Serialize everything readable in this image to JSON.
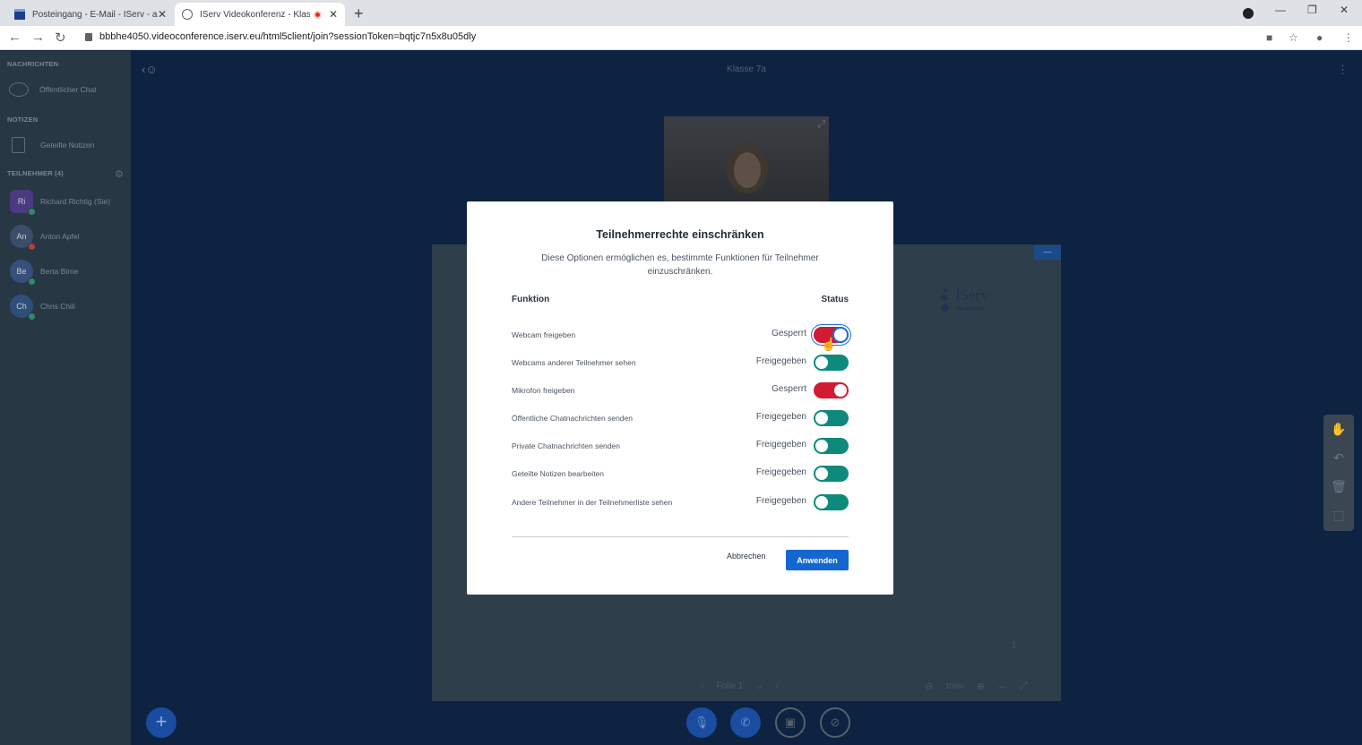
{
  "browser": {
    "tabs": [
      {
        "title": "Posteingang - E-Mail - IServ - ak"
      },
      {
        "title": "IServ Videokonferenz - Klass"
      }
    ],
    "url": "bbbhe4050.videoconference.iserv.eu/html5client/join?sessionToken=bqtjc7n5x8u05dly"
  },
  "sidebar": {
    "messages_title": "NACHRICHTEN",
    "public_chat": "Öffentlicher Chat",
    "notes_title": "NOTIZEN",
    "shared_notes": "Geteilte Notizen",
    "participants_title": "TEILNEHMER (4)",
    "users": [
      {
        "initials": "Ri",
        "name": "Richard Richtig (Sie)"
      },
      {
        "initials": "An",
        "name": "Anton Apfel"
      },
      {
        "initials": "Be",
        "name": "Berta Birne"
      },
      {
        "initials": "Ch",
        "name": "Chris Chili"
      }
    ]
  },
  "main": {
    "meeting_title": "Klasse 7a",
    "logo": {
      "name": "IServ",
      "sub": "Akademie"
    },
    "page_number": "1",
    "slide_label": "Folie 1",
    "zoom": "100%"
  },
  "modal": {
    "title": "Teilnehmerrechte einschränken",
    "description": "Diese Optionen ermöglichen es, bestimmte Funktionen für Teilnehmer einzuschränken.",
    "col_function": "Funktion",
    "col_status": "Status",
    "permissions": [
      {
        "label": "Webcam freigeben",
        "status": "Gesperrt",
        "locked": true
      },
      {
        "label": "Webcams anderer Teilnehmer sehen",
        "status": "Freigegeben",
        "locked": false
      },
      {
        "label": "Mikrofon freigeben",
        "status": "Gesperrt",
        "locked": true
      },
      {
        "label": "Öffentliche Chatnachrichten senden",
        "status": "Freigegeben",
        "locked": false
      },
      {
        "label": "Private Chatnachrichten senden",
        "status": "Freigegeben",
        "locked": false
      },
      {
        "label": "Geteilte Notizen bearbeiten",
        "status": "Freigegeben",
        "locked": false
      },
      {
        "label": "Andere Teilnehmer in der Teilnehmerliste sehen",
        "status": "Freigegeben",
        "locked": false
      }
    ],
    "cancel_label": "Abbrechen",
    "apply_label": "Anwenden"
  },
  "colors": {
    "locked": "#d11b33",
    "unlocked": "#0e8a7c",
    "primary": "#1467cf"
  }
}
